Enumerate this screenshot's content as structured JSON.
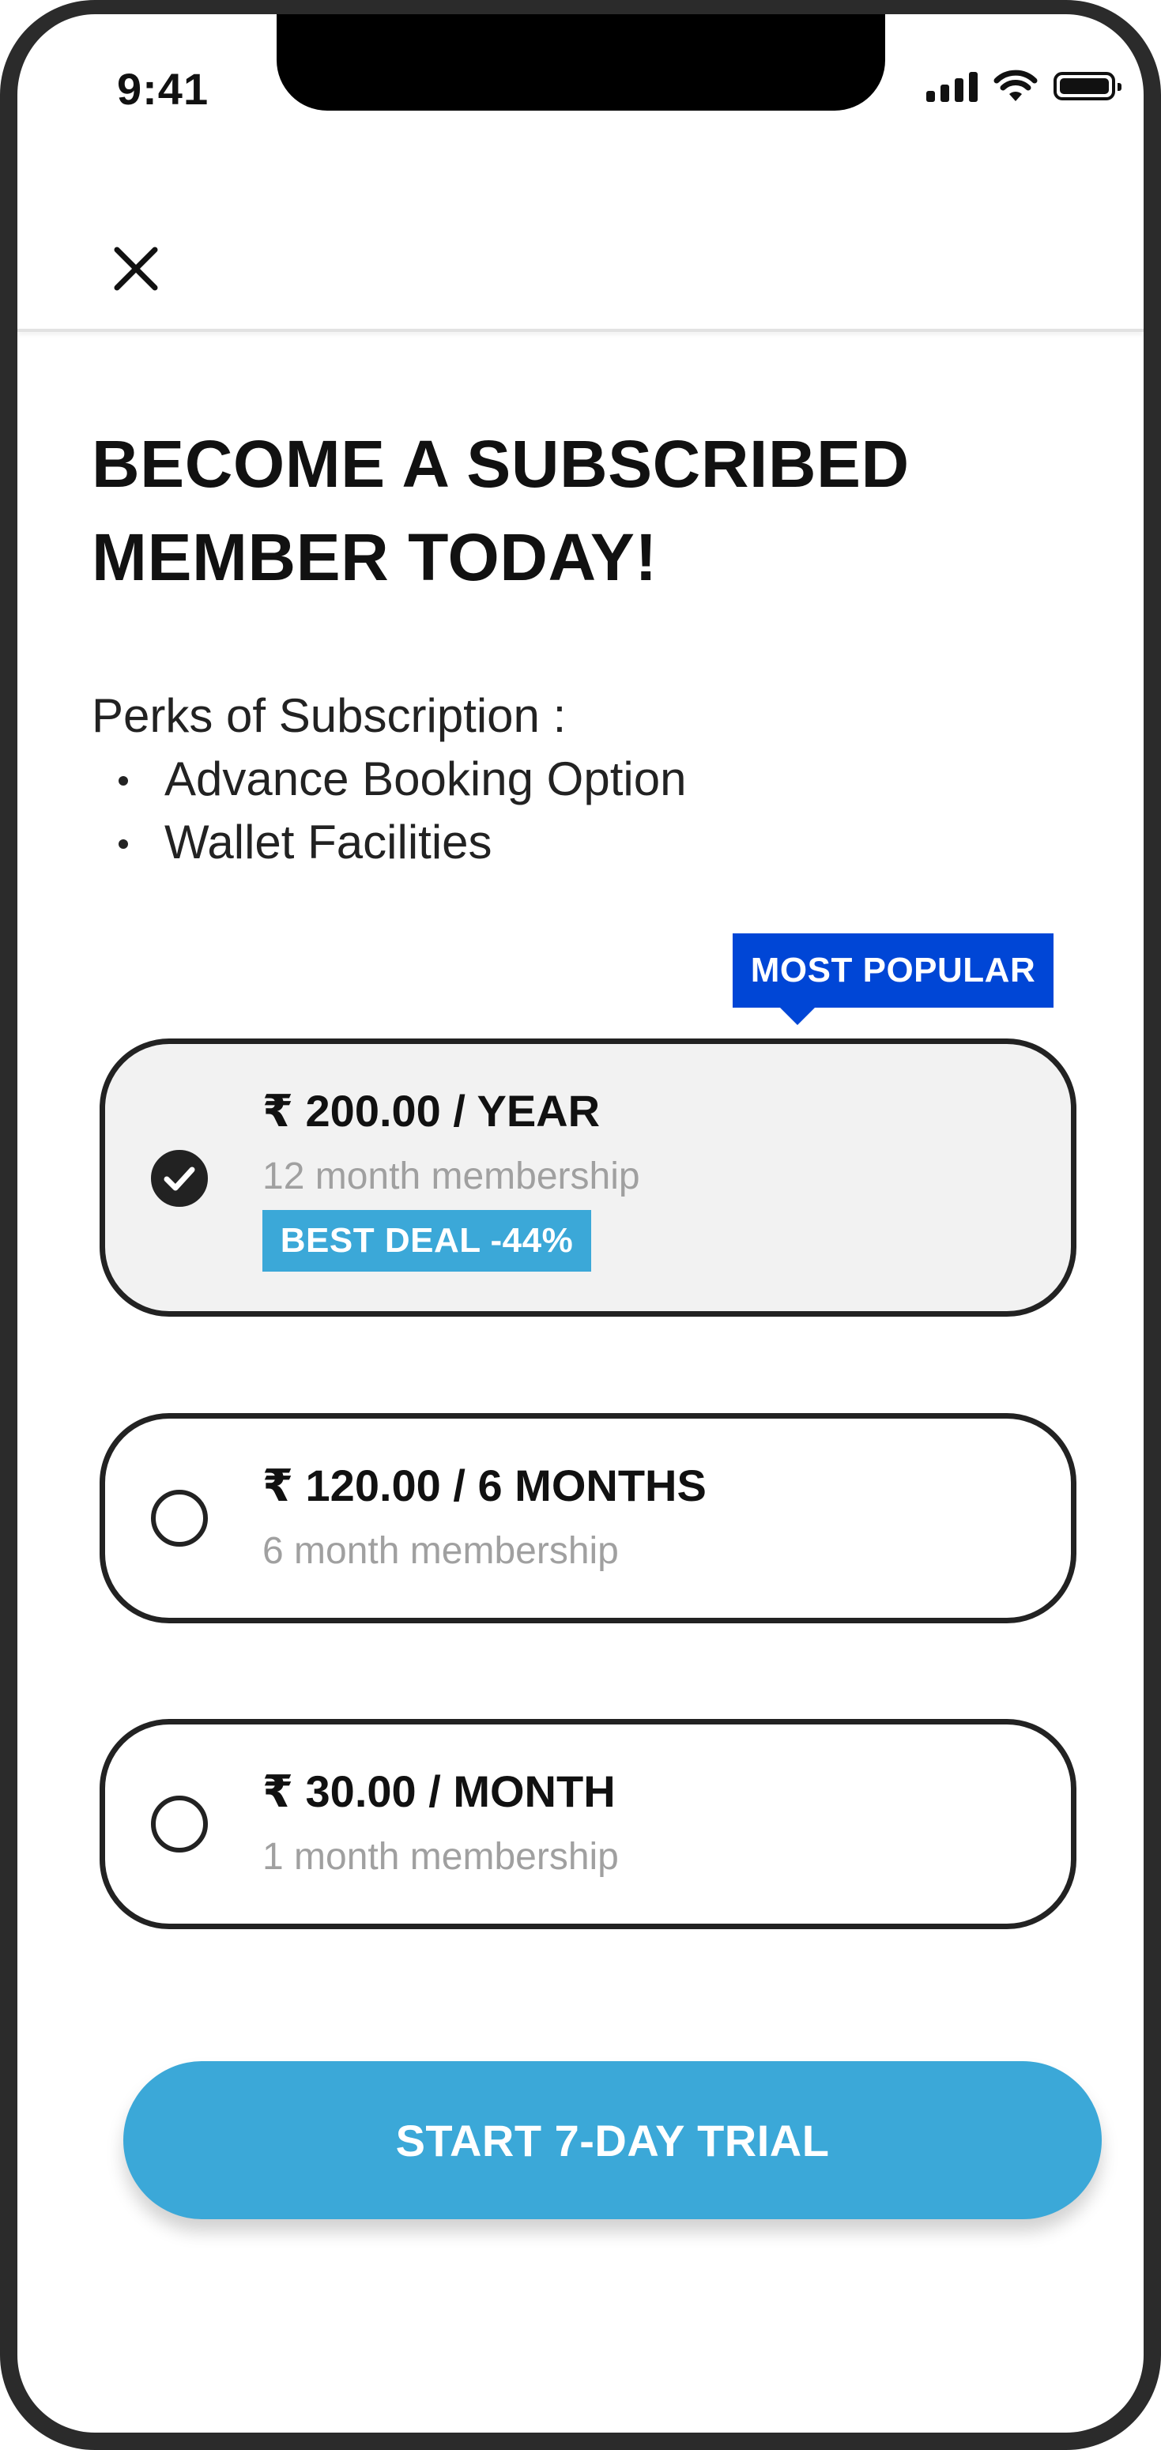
{
  "status_bar": {
    "time": "9:41",
    "icons": [
      "cellular-signal-icon",
      "wifi-icon",
      "battery-icon"
    ]
  },
  "header": {
    "close_icon": "close-icon"
  },
  "title": {
    "line1": "BECOME A SUBSCRIBED",
    "line2": "MEMBER TODAY!"
  },
  "perks": {
    "heading": "Perks of Subscription :",
    "items": [
      "Advance Booking Option",
      "Wallet Facilities"
    ]
  },
  "popular_badge": "MOST POPULAR",
  "plans": [
    {
      "price": "₹ 200.00 / YEAR",
      "subtitle": "12 month membership",
      "deal": "BEST DEAL -44%",
      "selected": true
    },
    {
      "price": "₹ 120.00 / 6 MONTHS",
      "subtitle": "6 month membership",
      "selected": false
    },
    {
      "price": "₹ 30.00 / MONTH",
      "subtitle": "1 month membership",
      "selected": false
    }
  ],
  "cta": {
    "label": "START 7-DAY TRIAL"
  },
  "colors": {
    "accent": "#3ba8d8",
    "badge_blue": "#0046d6",
    "selected_card_bg": "#f2f2f2",
    "text_dark": "#111111",
    "text_muted": "#a0a0a0"
  }
}
